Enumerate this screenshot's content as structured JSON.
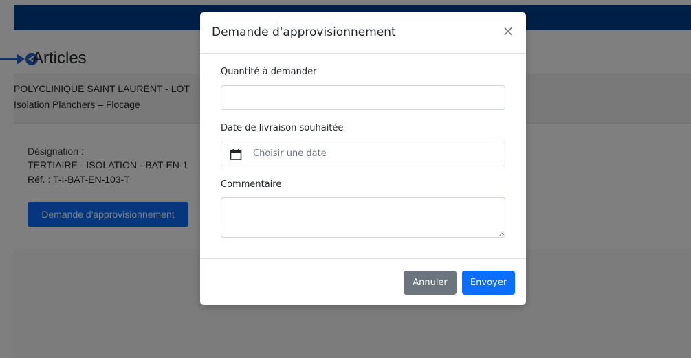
{
  "page": {
    "title": "Articles",
    "project_name": "POLYCLINIQUE SAINT LAURENT - LOT",
    "project_lot": "Isolation Planchers – Flocage",
    "article": {
      "designation_label": "Désignation :",
      "designation_value": "TERTIAIRE - ISOLATION - BAT-EN-1",
      "reference": "Réf. : T-I-BAT-EN-103-T"
    },
    "request_button_label": "Demande d'approvisionnement"
  },
  "modal": {
    "title": "Demande d'approvisionnement",
    "close_symbol": "×",
    "quantity_label": "Quantité à demander",
    "quantity_value": "",
    "date_label": "Date de livraison souhaitée",
    "date_placeholder": "Choisir une date",
    "comment_label": "Commentaire",
    "comment_value": "",
    "cancel_label": "Annuler",
    "send_label": "Envoyer"
  },
  "icons": {
    "back": "back-arrow-icon",
    "calendar": "calendar-icon",
    "close": "close-icon"
  },
  "colors": {
    "topbar": "#003f8f",
    "primary": "#0d6efd",
    "secondary": "#6c757d",
    "backdrop": "rgba(0,0,0,0.5)"
  }
}
